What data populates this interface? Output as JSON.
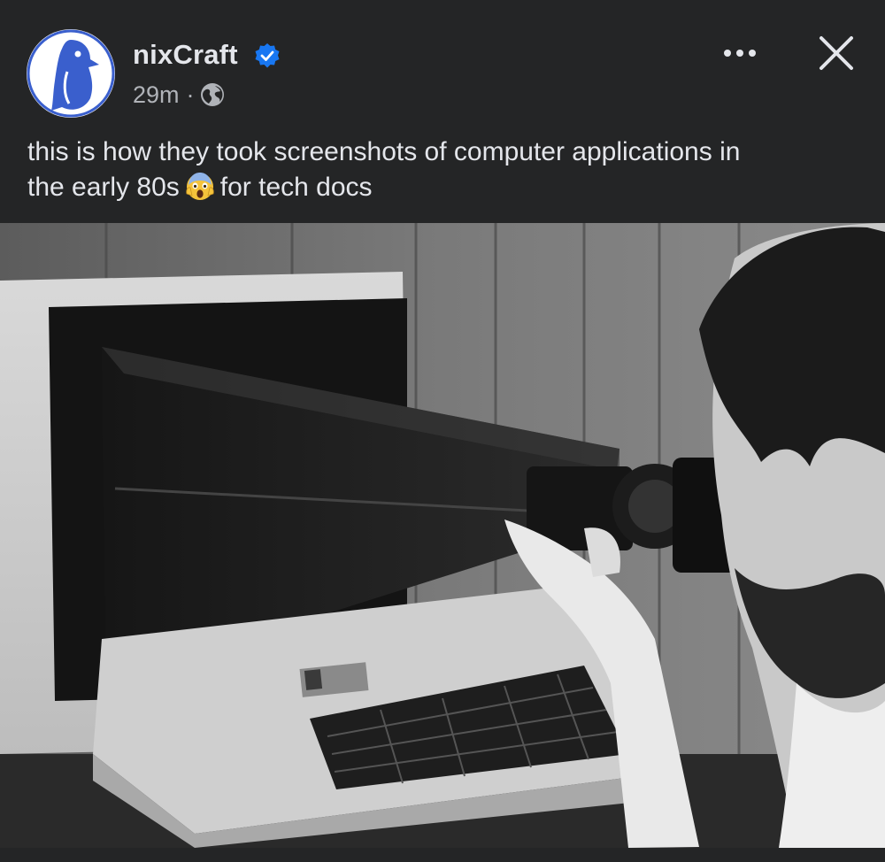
{
  "post": {
    "author": "nixCraft",
    "verified_icon": "verified-badge-icon",
    "time": "29m",
    "separator": "·",
    "audience_icon": "globe-icon",
    "caption_line1": "this is how they took screenshots of computer applications in",
    "caption_line2_before": "the early 80s",
    "caption_emoji": "screaming-face-emoji",
    "caption_line2_after": "for tech docs"
  },
  "actions": {
    "more_icon": "more-horizontal-icon",
    "close_icon": "close-icon"
  },
  "colors": {
    "background": "#242526",
    "text_primary": "#e4e6eb",
    "text_secondary": "#b0b3b8",
    "verified_blue": "#1877f2",
    "avatar_blue": "#3a5fcd"
  }
}
